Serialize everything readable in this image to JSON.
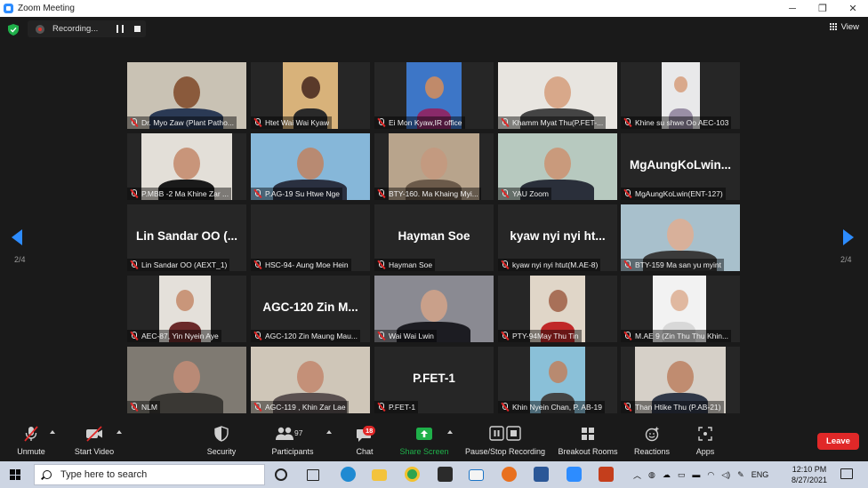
{
  "window": {
    "title": "Zoom Meeting",
    "minimize": "─",
    "restore": "❐",
    "close": "✕"
  },
  "recording": {
    "label": "Recording..."
  },
  "view": {
    "label": "View"
  },
  "pager": {
    "left": "2/4",
    "right": "2/4"
  },
  "participants": [
    {
      "name": "Dr. Myo Zaw (Plant Patho...",
      "big": ""
    },
    {
      "name": "Htet Wai Wai Kyaw",
      "big": ""
    },
    {
      "name": "Ei Mon Kyaw,IR office",
      "big": ""
    },
    {
      "name": "Khamm Myat Thu(P.FET-...",
      "big": ""
    },
    {
      "name": "Khine su shwe Oo AEC-103",
      "big": ""
    },
    {
      "name": "P.MBB -2 Ma Khine Zar ...",
      "big": ""
    },
    {
      "name": "P.AG-19 Su Htwe Nge",
      "big": ""
    },
    {
      "name": "BTY-160. Ma Khaing Myi...",
      "big": ""
    },
    {
      "name": "YAU Zoom",
      "big": ""
    },
    {
      "name": "MgAungKoLwin(ENT-127)",
      "big": "MgAungKoLwin..."
    },
    {
      "name": "Lin Sandar OO (AEXT_1)",
      "big": "Lin Sandar OO (..."
    },
    {
      "name": "HSC-94- Aung Moe Hein",
      "big": ""
    },
    {
      "name": "Hayman Soe",
      "big": "Hayman Soe"
    },
    {
      "name": "kyaw nyi nyi htut(M.AE-8)",
      "big": "kyaw nyi nyi ht..."
    },
    {
      "name": "BTY-159 Ma san yu myint",
      "big": ""
    },
    {
      "name": "AEC-87, Yin Nyein Aye",
      "big": ""
    },
    {
      "name": "AGC-120 Zin Maung Mau...",
      "big": "AGC-120 Zin M..."
    },
    {
      "name": "Wai Wai Lwin",
      "big": ""
    },
    {
      "name": "PTY-94May Thu Tin",
      "big": ""
    },
    {
      "name": "M.AE 9 (Zin Thu Thu Khin...",
      "big": ""
    },
    {
      "name": "NLM",
      "big": ""
    },
    {
      "name": "AGC-119 , Khin Zar Lae",
      "big": ""
    },
    {
      "name": "P.FET-1",
      "big": "P.FET-1"
    },
    {
      "name": "Khin Nyein Chan, P. AB-19",
      "big": ""
    },
    {
      "name": "Than Htike Thu (P.AB-21)",
      "big": ""
    }
  ],
  "toolbar": {
    "unmute": "Unmute",
    "start_video": "Start Video",
    "security": "Security",
    "participants": "Participants",
    "participants_count": "97",
    "chat": "Chat",
    "chat_badge": "18",
    "share_screen": "Share Screen",
    "pause_stop": "Pause/Stop Recording",
    "breakout": "Breakout Rooms",
    "reactions": "Reactions",
    "apps": "Apps",
    "leave": "Leave"
  },
  "taskbar": {
    "search_placeholder": "Type here to search",
    "lang": "ENG",
    "time": "12:10 PM",
    "date": "8/27/2021"
  },
  "colors": {
    "accent": "#2d8cff",
    "share": "#1fb04a",
    "leave": "#e02828",
    "mic_off": "#e02828"
  }
}
